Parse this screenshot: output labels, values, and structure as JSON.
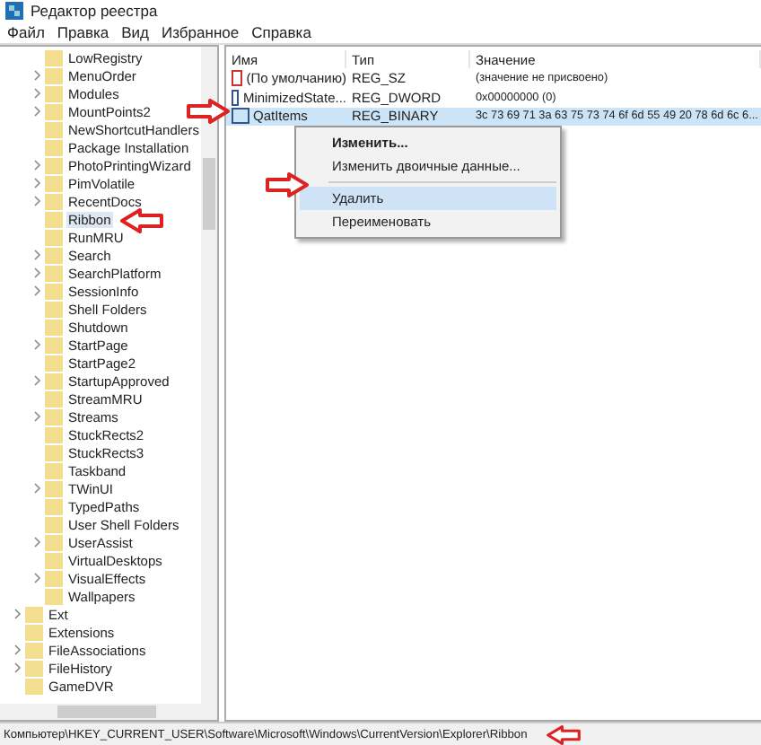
{
  "window": {
    "title": "Редактор реестра"
  },
  "menu": [
    "Файл",
    "Правка",
    "Вид",
    "Избранное",
    "Справка"
  ],
  "tree": [
    {
      "children": [
        {
          "name": "LowRegistry",
          "expandable": false,
          "selected": false
        },
        {
          "name": "MenuOrder",
          "expandable": true,
          "selected": false
        },
        {
          "name": "Modules",
          "expandable": true,
          "selected": false
        },
        {
          "name": "MountPoints2",
          "expandable": true,
          "selected": false
        },
        {
          "name": "NewShortcutHandlers",
          "expandable": false,
          "selected": false
        },
        {
          "name": "Package Installation",
          "expandable": false,
          "selected": false
        },
        {
          "name": "PhotoPrintingWizard",
          "expandable": true,
          "selected": false
        },
        {
          "name": "PimVolatile",
          "expandable": true,
          "selected": false
        },
        {
          "name": "RecentDocs",
          "expandable": true,
          "selected": false
        },
        {
          "name": "Ribbon",
          "expandable": false,
          "selected": true
        },
        {
          "name": "RunMRU",
          "expandable": false,
          "selected": false
        },
        {
          "name": "Search",
          "expandable": true,
          "selected": false
        },
        {
          "name": "SearchPlatform",
          "expandable": true,
          "selected": false
        },
        {
          "name": "SessionInfo",
          "expandable": true,
          "selected": false
        },
        {
          "name": "Shell Folders",
          "expandable": false,
          "selected": false
        },
        {
          "name": "Shutdown",
          "expandable": false,
          "selected": false
        },
        {
          "name": "StartPage",
          "expandable": true,
          "selected": false
        },
        {
          "name": "StartPage2",
          "expandable": false,
          "selected": false
        },
        {
          "name": "StartupApproved",
          "expandable": true,
          "selected": false
        },
        {
          "name": "StreamMRU",
          "expandable": false,
          "selected": false
        },
        {
          "name": "Streams",
          "expandable": true,
          "selected": false
        },
        {
          "name": "StuckRects2",
          "expandable": false,
          "selected": false
        },
        {
          "name": "StuckRects3",
          "expandable": false,
          "selected": false
        },
        {
          "name": "Taskband",
          "expandable": false,
          "selected": false
        },
        {
          "name": "TWinUI",
          "expandable": true,
          "selected": false
        },
        {
          "name": "TypedPaths",
          "expandable": false,
          "selected": false
        },
        {
          "name": "User Shell Folders",
          "expandable": false,
          "selected": false
        },
        {
          "name": "UserAssist",
          "expandable": true,
          "selected": false
        },
        {
          "name": "VirtualDesktops",
          "expandable": false,
          "selected": false
        },
        {
          "name": "VisualEffects",
          "expandable": true,
          "selected": false
        },
        {
          "name": "Wallpapers",
          "expandable": false,
          "selected": false
        }
      ]
    },
    {
      "name": "Ext",
      "expandable": true,
      "selected": false
    },
    {
      "name": "Extensions",
      "expandable": false,
      "selected": false
    },
    {
      "name": "FileAssociations",
      "expandable": true,
      "selected": false
    },
    {
      "name": "FileHistory",
      "expandable": true,
      "selected": false
    },
    {
      "name": "GameDVR",
      "expandable": false,
      "selected": false
    }
  ],
  "table": {
    "columns": [
      "Имя",
      "Тип",
      "Значение"
    ],
    "rows": [
      {
        "name": "(По умолчанию)",
        "kind": "string",
        "type": "REG_SZ",
        "value": "(значение не присвоено)",
        "selected": false
      },
      {
        "name": "MinimizedState...",
        "kind": "binary",
        "type": "REG_DWORD",
        "value": "0x00000000 (0)",
        "selected": false
      },
      {
        "name": "QatItems",
        "kind": "binary",
        "type": "REG_BINARY",
        "value": "3c 73 69 71 3a 63 75 73 74 6f 6d 55 49 20 78 6d 6c 6...",
        "selected": true
      }
    ]
  },
  "context_menu": [
    {
      "label": "Изменить...",
      "kind": "default",
      "selected": false
    },
    {
      "label": "Изменить двоичные данные...",
      "kind": "item",
      "selected": false
    },
    {
      "kind": "separator"
    },
    {
      "label": "Удалить",
      "kind": "item",
      "selected": true
    },
    {
      "label": "Переименовать",
      "kind": "item",
      "selected": false
    }
  ],
  "status_bar": "Компьютер\\HKEY_CURRENT_USER\\Software\\Microsoft\\Windows\\CurrentVersion\\Explorer\\Ribbon"
}
